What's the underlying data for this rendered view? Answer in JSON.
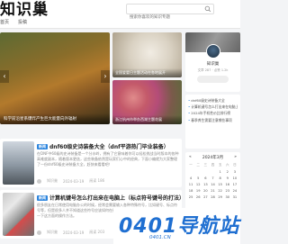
{
  "header": {
    "logo": "知识巢",
    "nav": [
      "首页",
      "投稿"
    ],
    "search_placeholder": "搜索你喜欢的知识专题"
  },
  "slider": {
    "main_caption": "科学前沿星系爆炸产生巨大能量向外辐射",
    "side_top_caption": "全国爱婴日主题活动在各地展开",
    "side_bottom_caption": "浙江杭州市举办西湖主题花展"
  },
  "posts": [
    {
      "badge": "新闻",
      "title": "dnf60级史诗装备大全（dnf平游热门毕业装备）",
      "excerpt": "在DNF中60级的史诗装备是一个分水岭，拥有了它意味着你可以轻松挑战当时版本的各种高难度副本，随着版本更迭，这些装备依然是玩家们心中的经典，下面小编就为大家整理了一份dnf60级史诗装备大全，赶快来看看吧！",
      "author": "知识巢",
      "date": "2024-03-19",
      "views": "阅读 186"
    },
    {
      "badge": "新闻",
      "title": "计算机键号怎么打出来在电脑上（标点符号键号的打法）",
      "excerpt": "很多朋友在日常使用电脑办公的时候，经常会需要输入各种特殊符号，比如键号、标点符号等，但是很多人并不知道这些符号应该如何在键盘上打出来，今天就来为大家详细介绍一下这方面的操作方法。",
      "author": "知识巢",
      "date": "2024-03-19",
      "views": "阅读 203"
    }
  ],
  "author_card": {
    "name": "知识巢",
    "stats": "文章 287 · 点赞 1.2k"
  },
  "hot_list": [
    "dnf60级史诗装备大全",
    "计算机键号怎么打出来在电脑上",
    "2024年手机性价比排行榜",
    "春季养生需要注意哪些事项"
  ],
  "calendar": {
    "title": "2024年3月",
    "prev": "«",
    "next": "»",
    "weekdays": [
      "一",
      "二",
      "三",
      "四",
      "五",
      "六",
      "日"
    ],
    "days": [
      "",
      "",
      "",
      "",
      "1",
      "2",
      "3",
      "4",
      "5",
      "6",
      "7",
      "8",
      "9",
      "10",
      "11",
      "12",
      "13",
      "14",
      "15",
      "16",
      "17",
      "18",
      "19",
      "20",
      "21",
      "22",
      "23",
      "24",
      "25",
      "26",
      "27",
      "28",
      "29",
      "30",
      "31"
    ]
  },
  "sidebar_cat": "热门文章",
  "overlay": {
    "big": "0401导航站",
    "url": "0401.CN"
  },
  "colors": {
    "accent": "#2e86de",
    "overlay_blue": "#1f6fd1"
  }
}
